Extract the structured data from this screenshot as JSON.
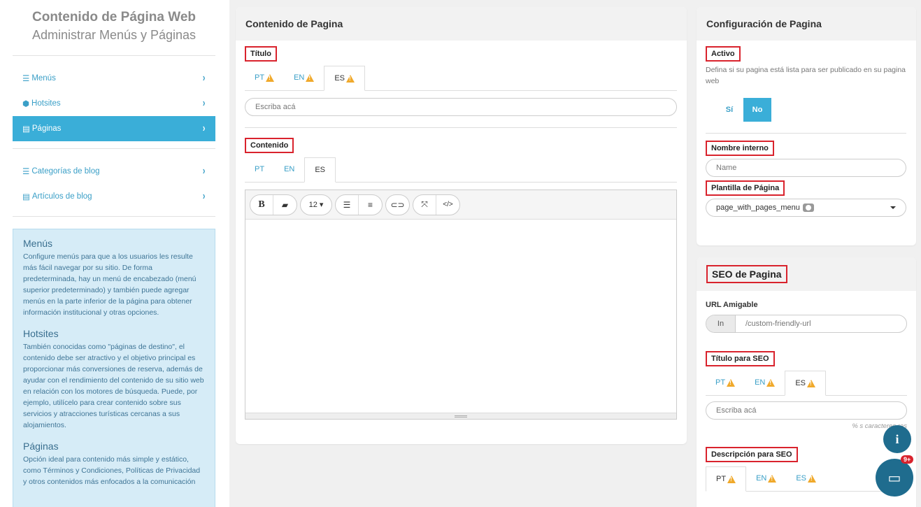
{
  "sidebar": {
    "title": "Contenido de Página Web",
    "subtitle": "Administrar Menús y Páginas",
    "group1": [
      {
        "label": "Menús",
        "icon": "list-icon"
      },
      {
        "label": "Hotsites",
        "icon": "cubes-icon"
      },
      {
        "label": "Páginas",
        "icon": "file-icon"
      }
    ],
    "group2": [
      {
        "label": "Categorías de blog",
        "icon": "list-icon"
      },
      {
        "label": "Artículos de blog",
        "icon": "file-icon"
      }
    ],
    "info": [
      {
        "heading": "Menús",
        "text": "Configure menús para que a los usuarios les resulte más fácil navegar por su sitio. De forma predeterminada, hay un menú de encabezado (menú superior predeterminado) y también puede agregar menús en la parte inferior de la página para obtener información institucional y otras opciones."
      },
      {
        "heading": "Hotsites",
        "text": "También conocidas como \"páginas de destino\", el contenido debe ser atractivo y el objetivo principal es proporcionar más conversiones de reserva, además de ayudar con el rendimiento del contenido de su sitio web en relación con los motores de búsqueda. Puede, por ejemplo, utilícelo para crear contenido sobre sus servicios y atracciones turísticas cercanas a sus alojamientos."
      },
      {
        "heading": "Páginas",
        "text": "Opción ideal para contenido más simple y estático, como Términos y Condiciones, Políticas de Privacidad y otros contenidos más enfocados a la comunicación"
      }
    ]
  },
  "content": {
    "header": "Contenido de Pagina",
    "title_label": "Título",
    "title_tabs": [
      "PT",
      "EN",
      "ES"
    ],
    "title_placeholder": "Escriba acá",
    "content_label": "Contenido",
    "content_tabs": [
      "PT",
      "EN",
      "ES"
    ],
    "font_size": "12"
  },
  "config": {
    "header": "Configuración de Pagina",
    "active_label": "Activo",
    "active_desc": "Defina si su pagina está lista para ser publicado en su pagina web",
    "yes": "Sí",
    "no": "No",
    "internal_name_label": "Nombre interno",
    "internal_name_placeholder": "Name",
    "template_label": "Plantilla de Página",
    "template_value": "page_with_pages_menu"
  },
  "seo": {
    "header": "SEO de Pagina",
    "url_label": "URL Amigable",
    "url_prefix": "In",
    "url_placeholder": "/custom-friendly-url",
    "title_label": "Título para SEO",
    "title_tabs": [
      "PT",
      "EN",
      "ES"
    ],
    "title_placeholder": "Escriba acá",
    "chars_hint": "% s caracteres res",
    "desc_label": "Descripción para SEO",
    "desc_tabs": [
      "PT",
      "EN",
      "ES"
    ]
  },
  "chat": {
    "badge": "9+"
  },
  "colors": {
    "accent": "#3aaed8",
    "link": "#3a9fc7",
    "highlight": "#d9232d",
    "warning": "#f0a92b"
  }
}
